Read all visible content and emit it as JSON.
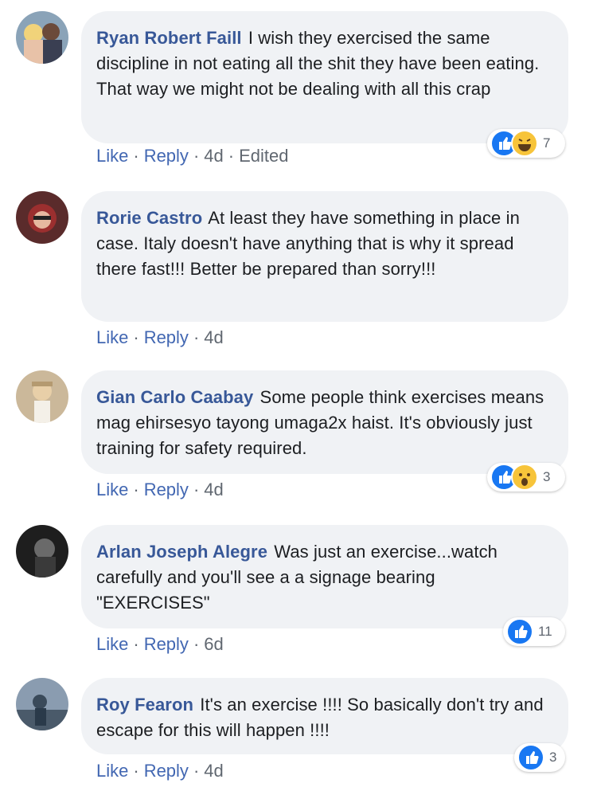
{
  "comments": [
    {
      "author": "Ryan Robert Faill",
      "text": "I wish they exercised the same discipline in not eating all the shit they have been eating. That way we might not be dealing with all this crap",
      "like": "Like",
      "reply": "Reply",
      "time": "4d",
      "edited": "Edited",
      "reactions": [
        "like",
        "haha"
      ],
      "reaction_count": "7"
    },
    {
      "author": "Rorie Castro",
      "text": "At least they have something in place in case. Italy doesn't have anything that is why it spread there fast!!! Better be prepared than sorry!!!",
      "like": "Like",
      "reply": "Reply",
      "time": "4d"
    },
    {
      "author": "Gian Carlo Caabay",
      "text": "Some people think exercises means mag ehirsesyo tayong umaga2x haist. It's obviously just training for safety required.",
      "like": "Like",
      "reply": "Reply",
      "time": "4d",
      "reactions": [
        "like",
        "wow"
      ],
      "reaction_count": "3"
    },
    {
      "author": "Arlan Joseph Alegre",
      "text": "Was just an exercise...watch carefully and you'll see a a signage bearing \"EXERCISES\"",
      "like": "Like",
      "reply": "Reply",
      "time": "6d",
      "reactions": [
        "like"
      ],
      "reaction_count": "11"
    },
    {
      "author": "Roy Fearon",
      "text": "It's an exercise !!!! So basically don't try and escape for this will happen !!!!",
      "like": "Like",
      "reply": "Reply",
      "time": "4d",
      "reactions": [
        "like"
      ],
      "reaction_count": "3"
    }
  ],
  "colors": {
    "author": "#385898",
    "link": "#4267b2",
    "bubble": "#f0f2f5",
    "like_blue": "#1877f2",
    "emoji_yellow": "#f7c43a"
  }
}
